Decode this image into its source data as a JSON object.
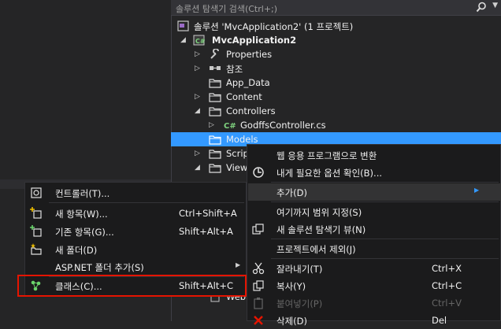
{
  "search": {
    "placeholder": "솔루션 탐색기 검색(Ctrl+;)"
  },
  "tree": [
    {
      "label": "솔루션 'MvcApplication2' (1 프로젝트)",
      "icon": "solution-icon"
    },
    {
      "label": "MvcApplication2",
      "icon": "csharp-project-icon"
    },
    {
      "label": "Properties",
      "icon": "wrench-icon"
    },
    {
      "label": "참조",
      "icon": "references-icon"
    },
    {
      "label": "App_Data",
      "icon": "folder-icon"
    },
    {
      "label": "Content",
      "icon": "folder-icon"
    },
    {
      "label": "Controllers",
      "icon": "folder-icon"
    },
    {
      "label": "GodffsController.cs",
      "icon": "csharp-file-icon"
    },
    {
      "label": "Models",
      "icon": "folder-icon"
    },
    {
      "label": "Scrip",
      "icon": "folder-icon"
    },
    {
      "label": "View",
      "icon": "folder-icon"
    },
    {
      "label": "Web",
      "icon": "config-file-icon"
    }
  ],
  "add_submenu": {
    "items": [
      {
        "label": "컨트롤러(T)...",
        "shortcut": ""
      },
      {
        "label": "새 항목(W)...",
        "shortcut": "Ctrl+Shift+A"
      },
      {
        "label": "기존 항목(G)...",
        "shortcut": "Shift+Alt+A"
      },
      {
        "label": "새 폴더(D)",
        "shortcut": ""
      },
      {
        "label": "ASP.NET 폴더 추가(S)",
        "shortcut": ""
      },
      {
        "label": "클래스(C)...",
        "shortcut": "Shift+Alt+C"
      }
    ]
  },
  "context_menu": {
    "items": [
      {
        "label": "웹 응용 프로그램으로 변환",
        "shortcut": ""
      },
      {
        "label": "내게 필요한 옵션 확인(B)...",
        "shortcut": ""
      },
      {
        "label": "추가(D)",
        "shortcut": ""
      },
      {
        "label": "여기까지 범위 지정(S)",
        "shortcut": ""
      },
      {
        "label": "새 솔루션 탐색기 뷰(N)",
        "shortcut": ""
      },
      {
        "label": "프로젝트에서 제외(J)",
        "shortcut": ""
      },
      {
        "label": "잘라내기(T)",
        "shortcut": "Ctrl+X"
      },
      {
        "label": "복사(Y)",
        "shortcut": "Ctrl+C"
      },
      {
        "label": "붙여넣기(P)",
        "shortcut": "Ctrl+V"
      },
      {
        "label": "삭제(D)",
        "shortcut": "Del"
      }
    ]
  },
  "colors": {
    "selection": "#3399ff",
    "highlight_box": "#e51400",
    "menu_bg": "#1b1b1c"
  }
}
